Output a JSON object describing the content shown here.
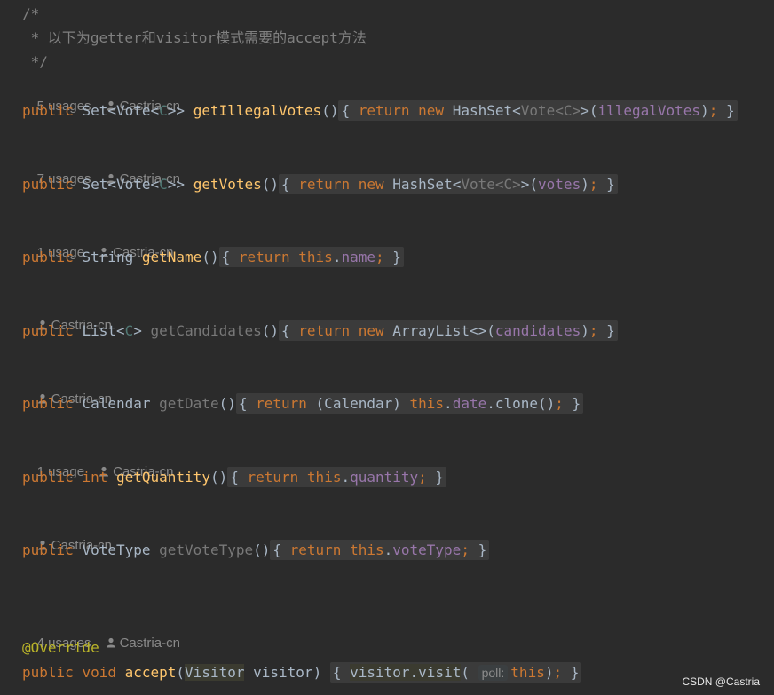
{
  "comment": {
    "open": "/*",
    "text": " * 以下为getter和visitor模式需要的accept方法",
    "close": " */"
  },
  "author": "Castria-cn",
  "person_icon": "person-icon",
  "methods": [
    {
      "usages": "5 usages",
      "modifier": "public",
      "ret_pre": "Set<Vote<",
      "ret_tp": "C",
      "ret_post": ">>",
      "name": "getIllegalVotes",
      "params": "()",
      "body_kw1": "return",
      "body_kw2": "new",
      "body_type": "HashSet<",
      "body_dim": "Vote<C>",
      "body_mid": ">(",
      "body_field": "illegalVotes",
      "body_end": ")"
    },
    {
      "usages": "7 usages",
      "modifier": "public",
      "ret_pre": "Set<Vote<",
      "ret_tp": "C",
      "ret_post": ">>",
      "name": "getVotes",
      "params": "()",
      "body_kw1": "return",
      "body_kw2": "new",
      "body_type": "HashSet<",
      "body_dim": "Vote<C>",
      "body_mid": ">(",
      "body_field": "votes",
      "body_end": ")"
    },
    {
      "usages": "1 usage",
      "modifier": "public",
      "ret": "String",
      "name": "getName",
      "params": "()",
      "body_kw1": "return",
      "body_this": "this",
      "body_field": "name"
    },
    {
      "usages": "",
      "modifier": "public",
      "ret_pre": "List<",
      "ret_tp": "C",
      "ret_post": ">",
      "name": "getCandidates",
      "params": "()",
      "body_kw1": "return",
      "body_kw2": "new",
      "body_type": "ArrayList<>(",
      "body_field": "candidates",
      "body_end": ")"
    },
    {
      "usages": "",
      "modifier": "public",
      "ret": "Calendar",
      "name": "getDate",
      "params": "()",
      "body_kw1": "return",
      "body_cast": "(Calendar)",
      "body_this": "this",
      "body_field": "date",
      "body_call": ".clone()"
    },
    {
      "usages": "1 usage",
      "modifier": "public",
      "ret_kw": "int",
      "name": "getQuantity",
      "params": "()",
      "body_kw1": "return",
      "body_this": "this",
      "body_field": "quantity"
    },
    {
      "usages": "",
      "modifier": "public",
      "ret": "VoteType",
      "name": "getVoteType",
      "params": "()",
      "body_kw1": "return",
      "body_this": "this",
      "body_field": "voteType"
    },
    {
      "usages": "4 usages",
      "annotation": "@Override",
      "modifier": "public",
      "ret_kw": "void",
      "name": "accept",
      "param_type": "Visitor",
      "param_name": "visitor",
      "body_obj": "visitor",
      "body_method": "visit",
      "hint": "poll:",
      "body_this": "this"
    }
  ],
  "watermark": "CSDN @Castria"
}
